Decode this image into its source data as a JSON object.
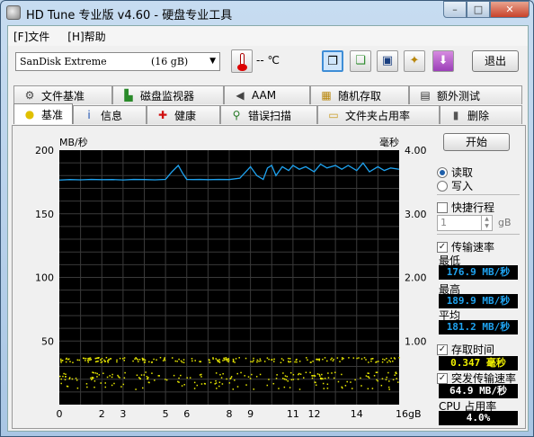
{
  "window": {
    "title": "HD Tune 专业版 v4.60 - 硬盘专业工具",
    "min": "–",
    "max": "□",
    "close": "✕"
  },
  "menu": {
    "file": "[F]文件",
    "help": "[H]帮助"
  },
  "toolbar": {
    "drive_name": "SanDisk Extreme",
    "drive_cap": "(16 gB)",
    "temp_value": "--",
    "temp_unit": "℃",
    "exit_label": "退出"
  },
  "tabs_top": [
    {
      "label": "文件基准",
      "icon": "gear-icon",
      "glyph": "⚙",
      "color": "#444"
    },
    {
      "label": "磁盘监视器",
      "icon": "bar-chart-icon",
      "glyph": "▙",
      "color": "#2a8a2a"
    },
    {
      "label": "AAM",
      "icon": "speaker-icon",
      "glyph": "◀",
      "color": "#444"
    },
    {
      "label": "随机存取",
      "icon": "dots-icon",
      "glyph": "▦",
      "color": "#b8860b"
    },
    {
      "label": "额外测试",
      "icon": "chart-icon",
      "glyph": "▤",
      "color": "#333"
    }
  ],
  "tabs_bottom": [
    {
      "label": "基准",
      "icon": "bulb-icon",
      "glyph": "●",
      "color": "#e0c000"
    },
    {
      "label": "信息",
      "icon": "info-icon",
      "glyph": "i",
      "color": "#1a4fb0"
    },
    {
      "label": "健康",
      "icon": "plus-icon",
      "glyph": "✚",
      "color": "#d01010"
    },
    {
      "label": "错误扫描",
      "icon": "magnifier-icon",
      "glyph": "⚲",
      "color": "#227722"
    },
    {
      "label": "文件夹占用率",
      "icon": "folder-icon",
      "glyph": "▭",
      "color": "#c89a20"
    },
    {
      "label": "删除",
      "icon": "trash-icon",
      "glyph": "▮",
      "color": "#555"
    }
  ],
  "side": {
    "start_label": "开始",
    "read_label": "读取",
    "write_label": "写入",
    "short_stroke_label": "快捷行程",
    "stroke_value": "1",
    "stroke_unit": "gB",
    "transfer_label": "传输速率",
    "min_label": "最低",
    "min_value": "176.9 MB/秒",
    "max_label": "最高",
    "max_value": "189.9 MB/秒",
    "avg_label": "平均",
    "avg_value": "181.2 MB/秒",
    "access_label": "存取时间",
    "access_value": "0.347 毫秒",
    "burst_label": "突发传输速率",
    "burst_value": "64.9 MB/秒",
    "cpu_label": "CPU 占用率",
    "cpu_value": "4.0%"
  },
  "chart_data": {
    "type": "line",
    "ylabel": "MB/秒",
    "y2label": "毫秒",
    "xunit": "gB",
    "ylim": [
      0,
      200
    ],
    "y2lim": [
      0,
      4
    ],
    "xlim": [
      0,
      16
    ],
    "yticks": [
      50,
      100,
      150,
      200
    ],
    "y2ticks": [
      "1.00",
      "2.00",
      "3.00",
      "4.00"
    ],
    "xticks": [
      0,
      2,
      3,
      5,
      6,
      8,
      9,
      11,
      12,
      14
    ],
    "grid": true,
    "series": [
      {
        "role": "transfer",
        "color": "#1fa3f0",
        "x": [
          0,
          0.5,
          1,
          1.5,
          2,
          2.5,
          3,
          3.5,
          4,
          4.5,
          5,
          5.3,
          5.6,
          5.8,
          6,
          6.3,
          6.6,
          7,
          7.5,
          8,
          8.5,
          9,
          9.3,
          9.6,
          9.8,
          10,
          10.2,
          10.5,
          10.8,
          11,
          11.3,
          11.6,
          12,
          12.3,
          12.6,
          13,
          13.3,
          13.6,
          14,
          14.3,
          14.6,
          15,
          15.3,
          15.6,
          16
        ],
        "y": [
          176.5,
          176.9,
          176.7,
          177,
          176.8,
          176.9,
          176.6,
          177,
          176.9,
          176.7,
          177,
          183,
          188,
          182,
          177,
          176.9,
          177,
          176.8,
          177,
          176.9,
          178,
          187,
          180,
          177,
          186,
          188,
          180,
          187,
          184,
          188,
          185,
          187,
          183,
          189,
          186,
          188,
          185,
          188,
          184,
          189.9,
          183,
          187,
          184,
          186,
          185
        ]
      },
      {
        "role": "access",
        "color": "#e8e800",
        "type": "scatter-band",
        "y_ms_range": [
          0.25,
          0.75
        ]
      }
    ]
  },
  "colors": {
    "plot_bg": "#000000",
    "grid": "#3a3a3a",
    "transfer": "#1fa3f0",
    "access": "#e8e800"
  }
}
